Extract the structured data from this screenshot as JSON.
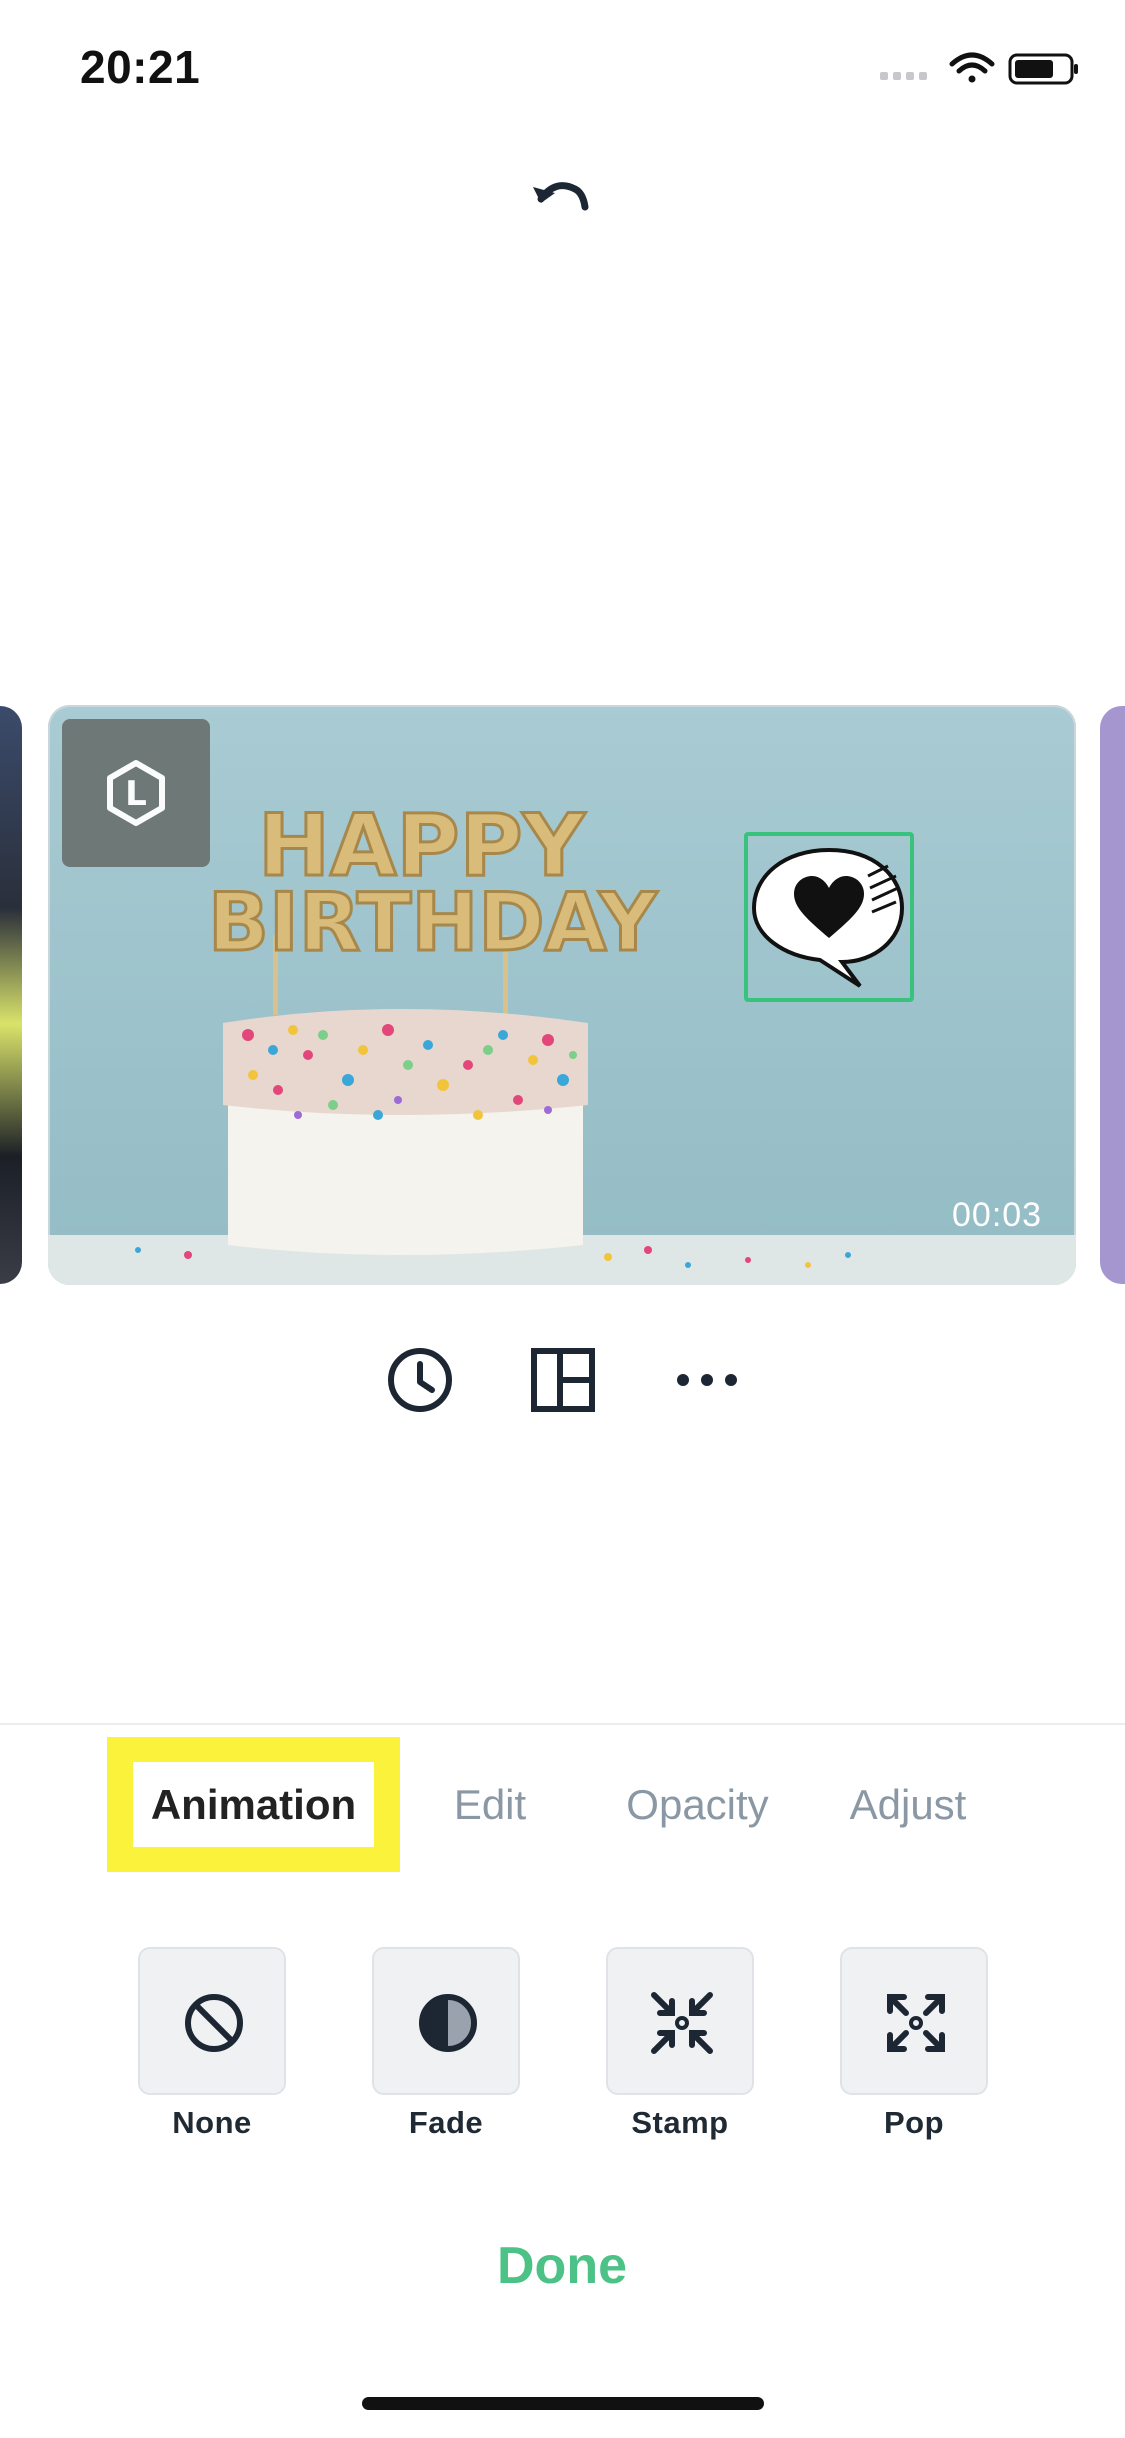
{
  "status_bar": {
    "time": "20:21",
    "signal_icon": "signal-icon",
    "wifi_icon": "wifi-icon",
    "battery_icon": "battery-icon"
  },
  "toolbar": {
    "undo_icon": "undo-icon"
  },
  "preview": {
    "layer_badge_icon": "layer-hexagon-icon",
    "layer_badge_letter": "L",
    "duration": "00:03",
    "sticker_icon": "speech-bubble-heart-icon",
    "selection_color": "#39c27c"
  },
  "tools": {
    "timing_icon": "clock-icon",
    "layout_icon": "layout-icon",
    "more_icon": "more-icon"
  },
  "tabs": [
    {
      "label": "Animation",
      "active": true
    },
    {
      "label": "Edit",
      "active": false
    },
    {
      "label": "Opacity",
      "active": false
    },
    {
      "label": "Adjust",
      "active": false
    }
  ],
  "animations": [
    {
      "label": "None",
      "icon": "none-icon"
    },
    {
      "label": "Fade",
      "icon": "fade-icon"
    },
    {
      "label": "Stamp",
      "icon": "stamp-icon"
    },
    {
      "label": "Pop",
      "icon": "pop-icon"
    }
  ],
  "done_label": "Done",
  "colors": {
    "accent": "#4cc287",
    "highlight": "#fbf23b",
    "inactive_tab": "#8a97a4"
  }
}
